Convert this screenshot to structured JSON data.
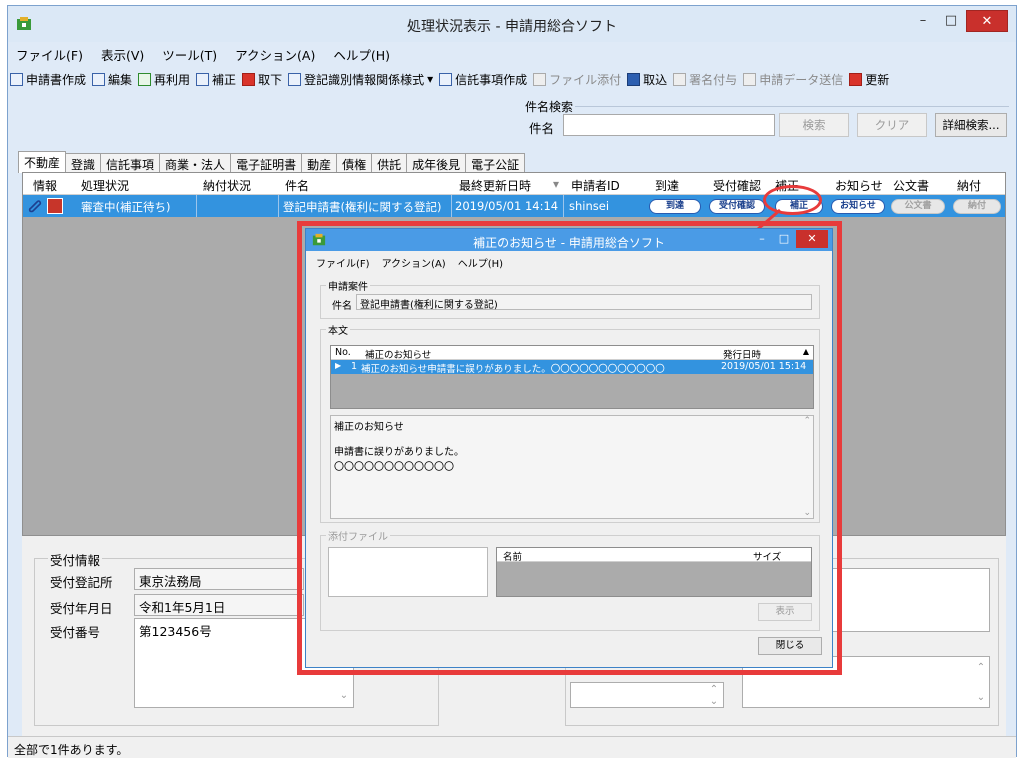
{
  "window": {
    "title": "処理状況表示 - 申請用総合ソフト",
    "btn_min": "–",
    "btn_max": "□",
    "btn_close": "✕"
  },
  "menu": [
    "ファイル(F)",
    "表示(V)",
    "ツール(T)",
    "アクション(A)",
    "ヘルプ(H)"
  ],
  "toolbar": {
    "create": "申請書作成",
    "edit": "編集",
    "reuse": "再利用",
    "correct": "補正",
    "withdraw": "取下",
    "registry": "登記識別情報関係様式",
    "dropdown": "▾",
    "trust": "信託事項作成",
    "attach": "ファイル添付",
    "import": "取込",
    "sign": "署名付与",
    "send": "申請データ送信",
    "refresh": "更新"
  },
  "search": {
    "legend": "件名検索",
    "label": "件名",
    "value": "",
    "search_btn": "検索",
    "clear_btn": "クリア",
    "detail_btn": "詳細検索..."
  },
  "tabs": [
    "不動産",
    "登識",
    "信託事項",
    "商業・法人",
    "電子証明書",
    "動産",
    "債権",
    "供託",
    "成年後見",
    "電子公証"
  ],
  "grid": {
    "headers": {
      "info": "情報",
      "status": "処理状況",
      "payment": "納付状況",
      "subject": "件名",
      "updated": "最終更新日時",
      "sort": "▾",
      "applicant": "申請者ID",
      "arrival": "到達",
      "receipt": "受付確認",
      "correction": "補正",
      "notice": "お知らせ",
      "official": "公文書",
      "pay": "納付"
    },
    "row": {
      "status": "審査中(補正待ち)",
      "payment": "",
      "subject": "登記申請書(権利に関する登記)",
      "updated": "2019/05/01 14:14",
      "applicant": "shinsei",
      "arrival": "到達",
      "receipt": "受付確認",
      "correction": "補正",
      "notice": "お知らせ",
      "official": "公文書",
      "pay": "納付"
    }
  },
  "reception": {
    "legend": "受付情報",
    "office_label": "受付登記所",
    "office_value": "東京法務局",
    "date_label": "受付年月日",
    "date_value": "令和1年5月1日",
    "number_label": "受付番号",
    "number_value": "第123456号"
  },
  "status_bar": "全部で1件あります。",
  "dialog": {
    "title": "補正のお知らせ - 申請用総合ソフト",
    "btn_min": "–",
    "btn_max": "□",
    "btn_close": "✕",
    "menu": [
      "ファイル(F)",
      "アクション(A)",
      "ヘルプ(H)"
    ],
    "case_legend": "申請案件",
    "case_label": "件名",
    "case_value": "登記申請書(権利に関する登記)",
    "body_legend": "本文",
    "list_headers": {
      "no": "No.",
      "notice": "補正のお知らせ",
      "date": "発行日時"
    },
    "list_row": {
      "no": "1",
      "notice": "補正のお知らせ申請書に誤りがありました。〇〇〇〇〇〇〇〇〇〇〇〇",
      "date": "2019/05/01 15:14"
    },
    "detail_title": "補正のお知らせ",
    "detail_line1": "申請書に誤りがありました。",
    "detail_line2": "〇〇〇〇〇〇〇〇〇〇〇〇",
    "attach_legend": "添付ファイル",
    "attach_headers": {
      "name": "名前",
      "size": "サイズ"
    },
    "show_btn": "表示",
    "close_btn": "閉じる"
  },
  "colors": {
    "selection": "#3393df",
    "highlight": "#e83b3b"
  }
}
